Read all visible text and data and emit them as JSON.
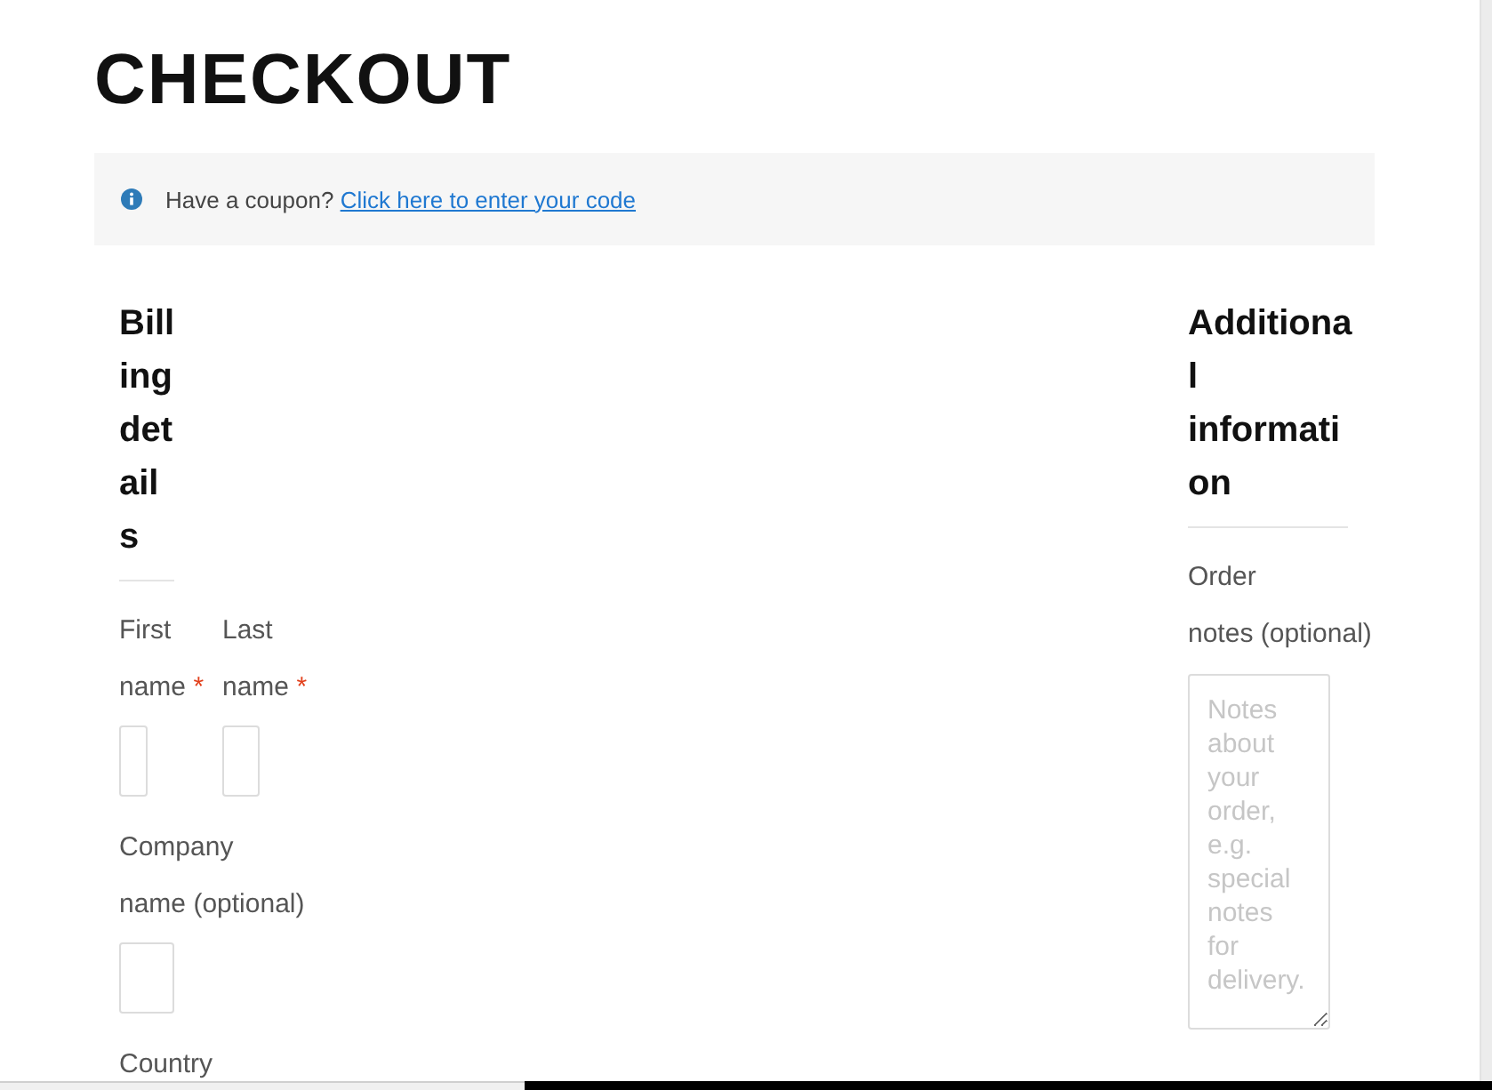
{
  "page": {
    "title": "CHECKOUT"
  },
  "coupon_notice": {
    "text": "Have a coupon?",
    "link": "Click here to enter your code"
  },
  "billing": {
    "heading": "Billing details",
    "name_fields": [
      {
        "label": "First name",
        "required_mark": "*"
      },
      {
        "label": "Last name",
        "required_mark": "*"
      }
    ],
    "fields": [
      {
        "kind": "text",
        "label": "Company name",
        "optional_note": "(optional)"
      },
      {
        "kind": "label_only",
        "label": "Country"
      }
    ]
  },
  "additional": {
    "heading": "Additional information",
    "order_notes": {
      "label": "Order notes",
      "optional_note": "(optional)",
      "placeholder": "Notes about your order, e.g. special notes for delivery."
    }
  }
}
